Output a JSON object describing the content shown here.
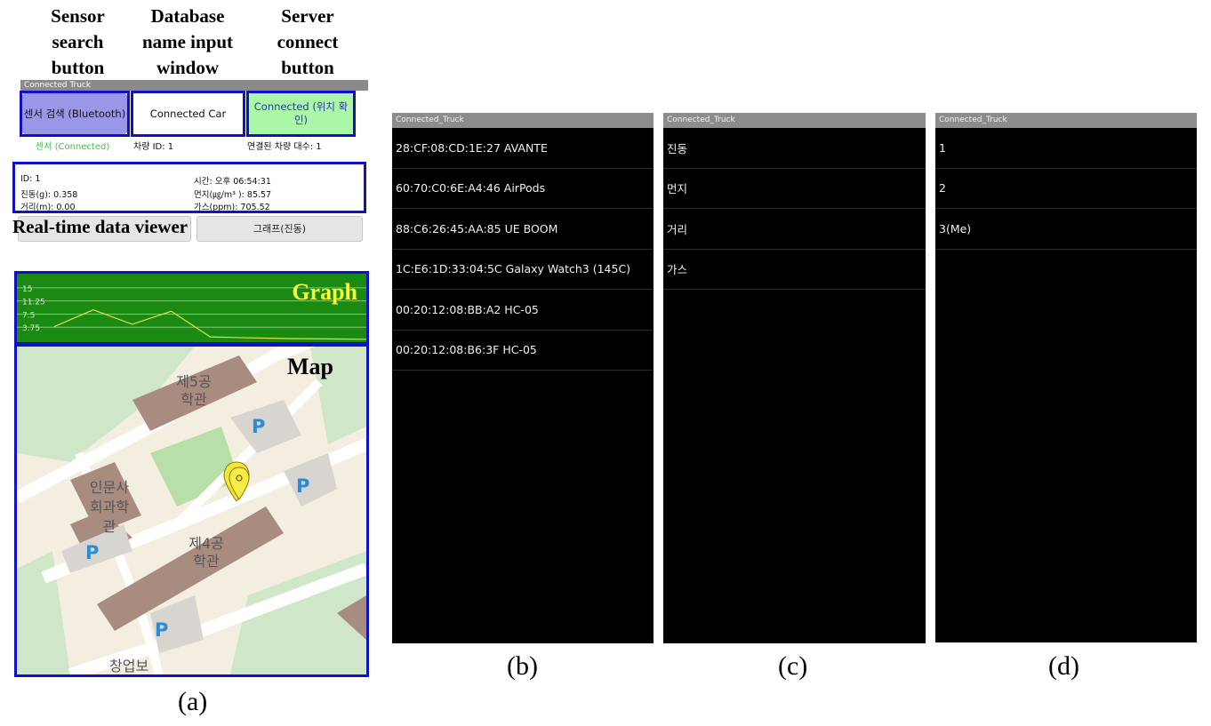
{
  "captions": {
    "sensor": "Sensor search button",
    "database": "Database name input window",
    "server": "Server connect button",
    "realtime": "Real-time data viewer",
    "graph": "Graph",
    "map": "Map"
  },
  "app": {
    "title": "Connected Truck",
    "sensor_button": "센서 검색 (Bluetooth)",
    "db_input_value": "Connected Car",
    "server_button": "Connected (위치 확인)",
    "sensor_status": "센서 (Connected)",
    "vehicle_id": "차량 ID: 1",
    "connected_count": "연결된 차량 대수: 1",
    "data": {
      "id": "ID: 1",
      "time": "시간: 오후 06:54:31",
      "vibration": "진동(g):  0.358",
      "dust": "먼지(㎍/m³ ): 85.57",
      "distance": "거리(m): 0.00",
      "gas": "가스(ppm): 705.52"
    },
    "graph_button": "그래프(진동)",
    "hidden_button": ""
  },
  "graph": {
    "y_ticks": [
      "15",
      "11.25",
      "7.5",
      "3.75"
    ],
    "series": [
      3.9,
      8.7,
      4.6,
      8.3,
      1.0,
      0.7,
      0.5,
      0.4,
      0.3
    ],
    "ylim": [
      0,
      17
    ]
  },
  "map": {
    "labels": {
      "bldg5": "제5공 학관",
      "humanities": "인문사 회과학 관",
      "bldg4": "제4공 학관",
      "startup": "창업보"
    },
    "parking": "P"
  },
  "panels": [
    {
      "title": "Connected_Truck",
      "items": [
        "28:CF:08:CD:1E:27 AVANTE",
        "60:70:C0:6E:A4:46 AirPods",
        "88:C6:26:45:AA:85 UE BOOM",
        "1C:E6:1D:33:04:5C Galaxy Watch3 (145C)",
        "00:20:12:08:BB:A2 HC-05",
        "00:20:12:08:B6:3F HC-05"
      ]
    },
    {
      "title": "Connected_Truck",
      "items": [
        "진동",
        "먼지",
        "거리",
        "가스"
      ]
    },
    {
      "title": "Connected_Truck",
      "items": [
        "1",
        "2",
        "3(Me)"
      ]
    }
  ],
  "subcaptions": [
    "(a)",
    "(b)",
    "(c)",
    "(d)"
  ],
  "colors": {
    "highlight": "#1010c8",
    "sensor_button": "#9b97e8",
    "server_button": "#aaf7a8",
    "graph_bg": "#1a8a12",
    "graph_label": "#ffff33",
    "connected_green": "#3fc03f"
  }
}
